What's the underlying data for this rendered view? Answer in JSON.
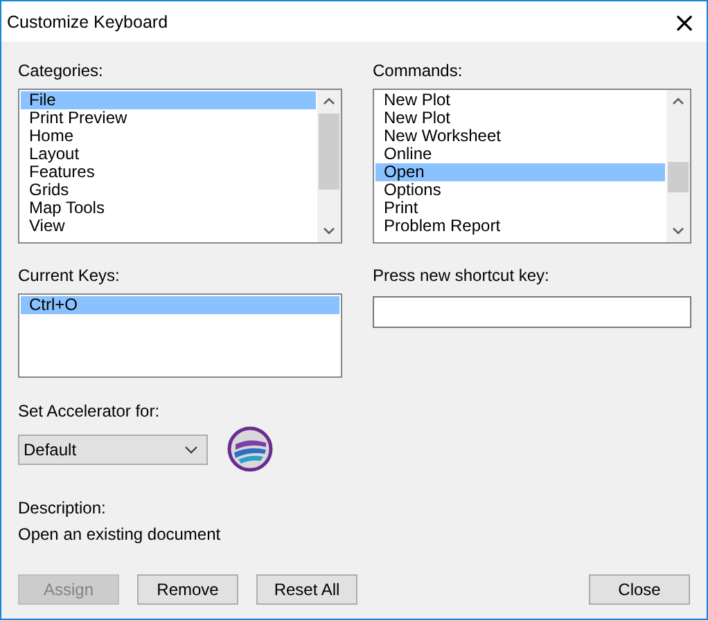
{
  "window": {
    "title": "Customize Keyboard",
    "close": "×"
  },
  "categories": {
    "label": "Categories:",
    "items": [
      {
        "label": "File",
        "selected": true
      },
      {
        "label": "Print Preview",
        "selected": false
      },
      {
        "label": "Home",
        "selected": false
      },
      {
        "label": "Layout",
        "selected": false
      },
      {
        "label": "Features",
        "selected": false
      },
      {
        "label": "Grids",
        "selected": false
      },
      {
        "label": "Map Tools",
        "selected": false
      },
      {
        "label": "View",
        "selected": false
      }
    ]
  },
  "commands": {
    "label": "Commands:",
    "items": [
      {
        "label": "New Plot",
        "selected": false
      },
      {
        "label": "New Plot",
        "selected": false
      },
      {
        "label": "New Worksheet",
        "selected": false
      },
      {
        "label": "Online",
        "selected": false
      },
      {
        "label": "Open",
        "selected": true
      },
      {
        "label": "Options",
        "selected": false
      },
      {
        "label": "Print",
        "selected": false
      },
      {
        "label": "Problem Report",
        "selected": false
      }
    ]
  },
  "current_keys": {
    "label": "Current Keys:",
    "items": [
      {
        "label": "Ctrl+O",
        "selected": true
      }
    ]
  },
  "new_shortcut": {
    "label": "Press new shortcut key:"
  },
  "accelerator": {
    "label": "Set Accelerator for:",
    "value": "Default"
  },
  "description": {
    "label": "Description:",
    "text": "Open an existing document"
  },
  "buttons": [
    {
      "label": "Assign",
      "disabled": true
    },
    {
      "label": "Remove",
      "disabled": false
    },
    {
      "label": "Reset All",
      "disabled": false
    },
    {
      "label": "Close",
      "disabled": false
    }
  ]
}
